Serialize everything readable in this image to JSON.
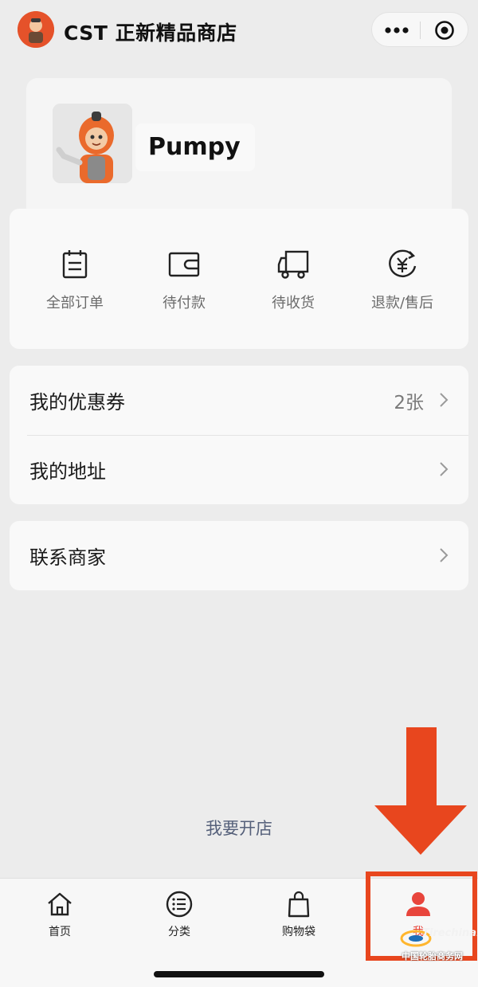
{
  "header": {
    "shop_name": "CST 正新精品商店",
    "menu_icon": "more-dots-icon",
    "close_icon": "target-circle-icon"
  },
  "profile": {
    "username": "Pumpy"
  },
  "orders": [
    {
      "label": "全部订单",
      "icon": "clipboard-icon"
    },
    {
      "label": "待付款",
      "icon": "wallet-icon"
    },
    {
      "label": "待收货",
      "icon": "truck-icon"
    },
    {
      "label": "退款/售后",
      "icon": "yuan-refund-icon"
    }
  ],
  "menu": {
    "coupons": {
      "label": "我的优惠券",
      "value": "2张"
    },
    "address": {
      "label": "我的地址"
    },
    "contact": {
      "label": "联系商家"
    }
  },
  "open_shop_label": "我要开店",
  "tabbar": [
    {
      "label": "首页",
      "icon": "home-icon"
    },
    {
      "label": "分类",
      "icon": "list-icon"
    },
    {
      "label": "购物袋",
      "icon": "bag-icon"
    },
    {
      "label": "我",
      "icon": "user-icon",
      "active": true
    }
  ],
  "colors": {
    "accent": "#e8453c",
    "annotation": "#e8461e",
    "background": "#ececec"
  },
  "watermark": {
    "brand": "Tirechina.net",
    "text": "中国轮胎商务网"
  }
}
